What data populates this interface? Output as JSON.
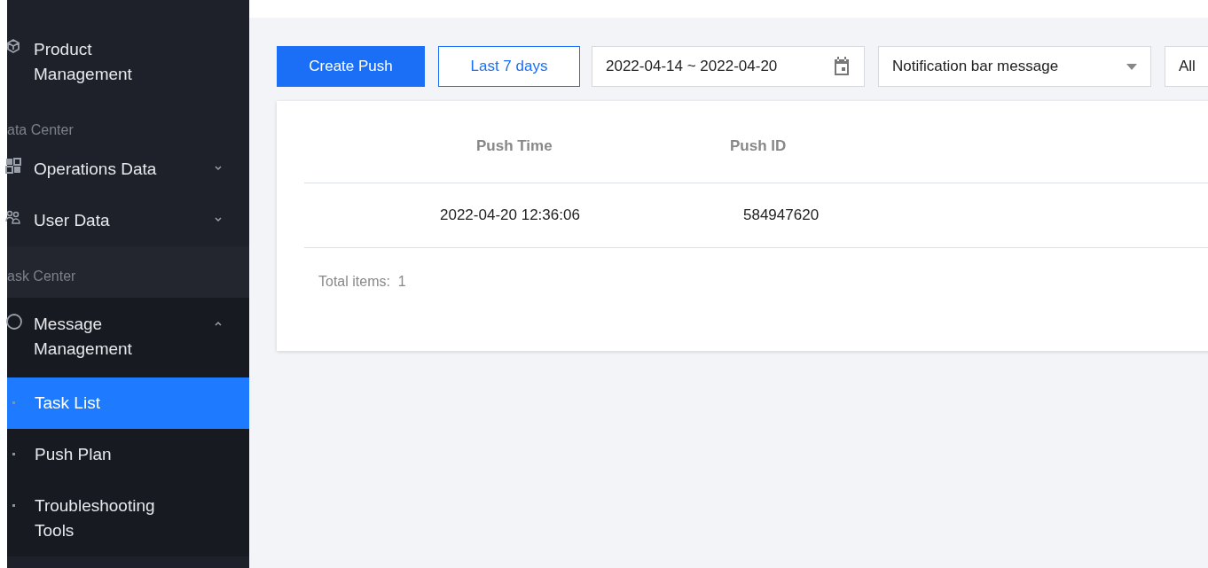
{
  "sidebar": {
    "items": [
      {
        "kind": "item",
        "label": "Product Management"
      },
      {
        "kind": "section",
        "label": "ata Center"
      },
      {
        "kind": "item",
        "label": "Operations Data",
        "expanded": false
      },
      {
        "kind": "item",
        "label": "User Data",
        "expanded": false
      },
      {
        "kind": "section",
        "label": "ask Center"
      },
      {
        "kind": "item",
        "label": "Message Management",
        "expanded": true,
        "children": [
          {
            "label": "Task List",
            "selected": true
          },
          {
            "label": "Push Plan",
            "selected": false
          },
          {
            "label": "Troubleshooting Tools",
            "selected": false
          }
        ]
      }
    ]
  },
  "toolbar": {
    "create_button": "Create Push",
    "range_button": "Last 7 days",
    "date_range": "2022-04-14 ~ 2022-04-20",
    "type_select": "Notification bar message",
    "status_select": "All"
  },
  "table": {
    "columns": [
      "Push Time",
      "Push ID"
    ],
    "rows": [
      [
        "2022-04-20 12:36:06",
        "584947620"
      ]
    ],
    "total": "Total items:  1"
  }
}
